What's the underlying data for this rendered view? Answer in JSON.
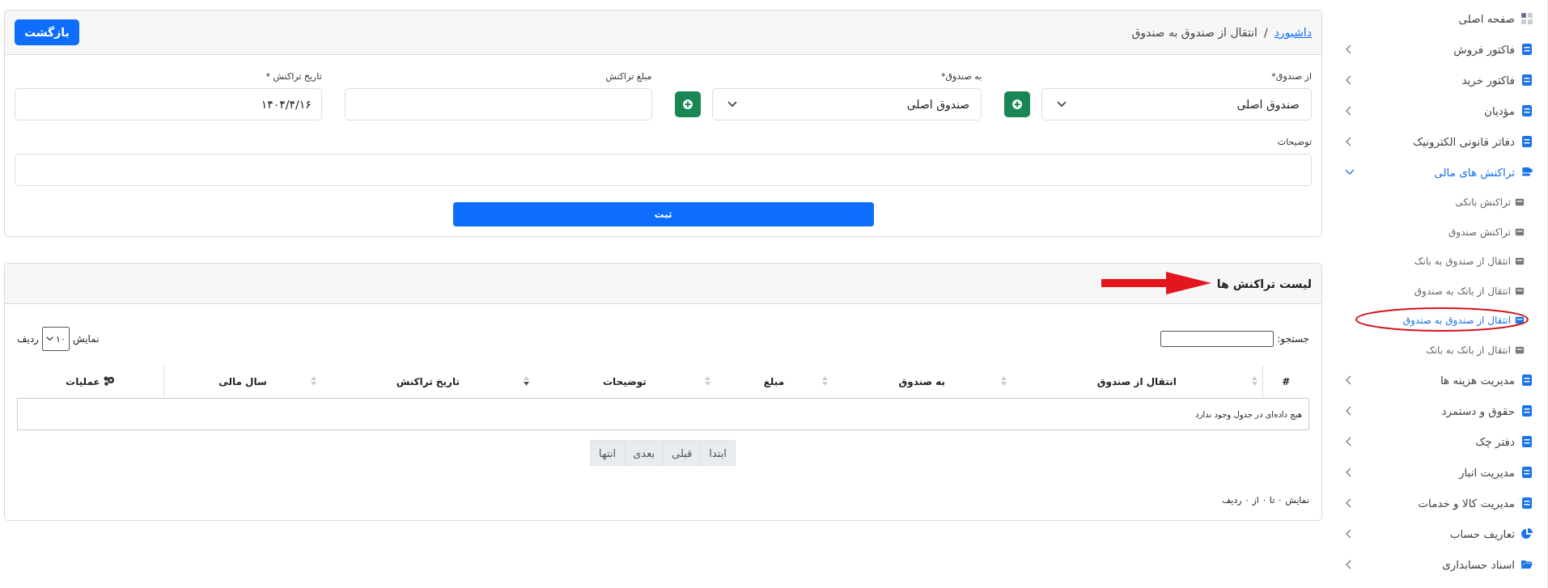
{
  "breadcrumb": {
    "link": "داشبورد",
    "separator": "/",
    "current": "انتقال از صندوق به صندوق"
  },
  "back_button": "بازگشت",
  "form": {
    "from_fund": {
      "label": "از صندوق*",
      "value": "صندوق اصلی"
    },
    "to_fund": {
      "label": "به صندوق*",
      "value": "صندوق اصلی"
    },
    "amount": {
      "label": "مبلغ تراکنش"
    },
    "date": {
      "label": "تاریخ تراکنش *",
      "value": "۱۴۰۴/۴/۱۶"
    },
    "description": {
      "label": "توضیحات"
    },
    "submit": "ثبت"
  },
  "list": {
    "title": "لیست تراکنش ها",
    "search_label": "جستجو:",
    "length": {
      "prefix": "نمایش",
      "value": "۱۰",
      "suffix": "ردیف"
    },
    "columns": [
      {
        "label": "#",
        "sortable": false
      },
      {
        "label": "انتقال از صندوق",
        "sortable": true,
        "sorted": false
      },
      {
        "label": "به صندوق",
        "sortable": true,
        "sorted": false
      },
      {
        "label": "مبلغ",
        "sortable": true,
        "sorted": false
      },
      {
        "label": "توضیحات",
        "sortable": true,
        "sorted": false
      },
      {
        "label": "تاریخ تراکنش",
        "sortable": true,
        "sorted": true
      },
      {
        "label": "سال مالی",
        "sortable": true,
        "sorted": false
      },
      {
        "label": "عملیات",
        "sortable": false,
        "kind": "actions"
      }
    ],
    "empty_text": "هیچ داده‌ای در جدول وجود ندارد",
    "pagination": [
      {
        "label": "ابتدا",
        "disabled": true
      },
      {
        "label": "قبلی",
        "disabled": true
      },
      {
        "label": "بعدی",
        "disabled": true
      },
      {
        "label": "انتها",
        "disabled": true
      }
    ],
    "info": "نمایش ۰ تا ۰ از ۰ ردیف"
  },
  "sidebar": {
    "items": [
      {
        "label": "صفحه اصلی"
      },
      {
        "label": "فاکتور فروش",
        "expanded": false
      },
      {
        "label": "فاکتور خرید",
        "expanded": false
      },
      {
        "label": "مؤدیان",
        "expanded": false
      },
      {
        "label": "دفاتر قانونی الکترونیک",
        "expanded": false
      },
      {
        "label": "تراکنش های مالی",
        "expanded": true,
        "children": [
          {
            "label": "تراکنش بانکی",
            "selected": false
          },
          {
            "label": "تراکنش صندوق",
            "selected": false
          },
          {
            "label": "انتقال از صندوق به بانک",
            "selected": false
          },
          {
            "label": "انتقال از بانک به صندوق",
            "selected": false
          },
          {
            "label": "انتقال از صندوق به صندوق",
            "selected": true
          },
          {
            "label": "انتقال از بانک به بانک",
            "selected": false
          }
        ]
      },
      {
        "label": "مدیریت هزینه ها",
        "expanded": false
      },
      {
        "label": "حقوق و دستمرد",
        "expanded": false
      },
      {
        "label": "دفتر چک",
        "expanded": false
      },
      {
        "label": "مدیریت انبار",
        "expanded": false
      },
      {
        "label": "مدیریت کالا و خدمات",
        "expanded": false
      },
      {
        "label": "تعاریف حساب",
        "expanded": false
      },
      {
        "label": "اسناد حسابداری",
        "expanded": false
      }
    ]
  }
}
